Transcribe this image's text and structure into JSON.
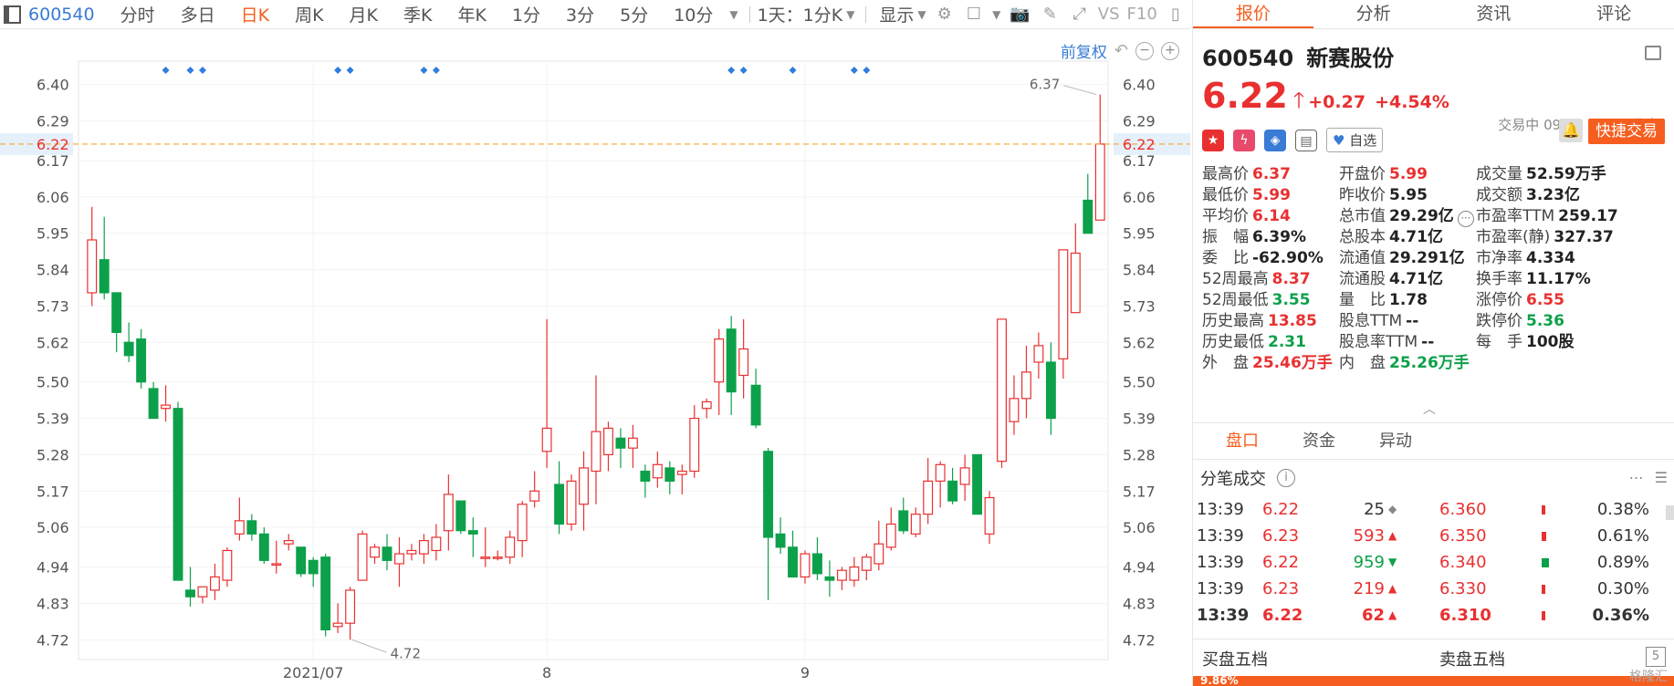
{
  "toolbar": {
    "code": "600540",
    "periods": [
      "分时",
      "多日",
      "日K",
      "周K",
      "月K",
      "季K",
      "年K",
      "1分",
      "3分",
      "5分",
      "10分"
    ],
    "active_period": "日K",
    "interval_select": "1天：1分K",
    "display_label": "显示",
    "vs_label": "VS",
    "f10_label": "F10"
  },
  "chart": {
    "adjust_label": "前复权",
    "y_ticks": [
      "6.40",
      "6.29",
      "6.17",
      "6.06",
      "5.95",
      "5.84",
      "5.73",
      "5.62",
      "5.50",
      "5.39",
      "5.28",
      "5.17",
      "5.06",
      "4.94",
      "4.83",
      "4.72"
    ],
    "current_price_label": "6.22",
    "high_annotation": "6.37",
    "low_annotation": "4.72",
    "x_labels": [
      "2021/07",
      "8",
      "9"
    ],
    "colors": {
      "up": "#e93030",
      "down": "#0da04a",
      "price_line": "#f5a623",
      "marker": "#2f7de1"
    }
  },
  "chart_data": {
    "type": "candlestick",
    "y_range": [
      4.66,
      6.46
    ],
    "x_labels": [
      {
        "label": "2021/07",
        "index": 18
      },
      {
        "label": "8",
        "index": 37
      },
      {
        "label": "9",
        "index": 58
      }
    ],
    "event_marker_indices": [
      6,
      8,
      9,
      20,
      21,
      27,
      28,
      52,
      53,
      57,
      62,
      63
    ],
    "candles": [
      {
        "o": 5.77,
        "h": 6.03,
        "l": 5.73,
        "c": 5.93
      },
      {
        "o": 5.87,
        "h": 6.0,
        "l": 5.75,
        "c": 5.77
      },
      {
        "o": 5.77,
        "h": 5.77,
        "l": 5.59,
        "c": 5.65
      },
      {
        "o": 5.62,
        "h": 5.68,
        "l": 5.56,
        "c": 5.58
      },
      {
        "o": 5.63,
        "h": 5.66,
        "l": 5.48,
        "c": 5.5
      },
      {
        "o": 5.48,
        "h": 5.5,
        "l": 5.39,
        "c": 5.39
      },
      {
        "o": 5.42,
        "h": 5.49,
        "l": 5.38,
        "c": 5.43
      },
      {
        "o": 5.42,
        "h": 5.44,
        "l": 4.9,
        "c": 4.9
      },
      {
        "o": 4.87,
        "h": 4.94,
        "l": 4.82,
        "c": 4.85
      },
      {
        "o": 4.85,
        "h": 4.88,
        "l": 4.83,
        "c": 4.88
      },
      {
        "o": 4.87,
        "h": 4.95,
        "l": 4.84,
        "c": 4.91
      },
      {
        "o": 4.9,
        "h": 5.0,
        "l": 4.88,
        "c": 4.99
      },
      {
        "o": 5.04,
        "h": 5.15,
        "l": 5.02,
        "c": 5.08
      },
      {
        "o": 5.08,
        "h": 5.1,
        "l": 5.02,
        "c": 5.04
      },
      {
        "o": 5.04,
        "h": 5.06,
        "l": 4.95,
        "c": 4.96
      },
      {
        "o": 4.95,
        "h": 5.02,
        "l": 4.92,
        "c": 4.95
      },
      {
        "o": 5.01,
        "h": 5.04,
        "l": 4.99,
        "c": 5.02
      },
      {
        "o": 5.0,
        "h": 5.0,
        "l": 4.91,
        "c": 4.92
      },
      {
        "o": 4.96,
        "h": 4.97,
        "l": 4.88,
        "c": 4.92
      },
      {
        "o": 4.97,
        "h": 4.98,
        "l": 4.73,
        "c": 4.75
      },
      {
        "o": 4.76,
        "h": 4.83,
        "l": 4.74,
        "c": 4.77
      },
      {
        "o": 4.77,
        "h": 4.88,
        "l": 4.72,
        "c": 4.87
      },
      {
        "o": 4.9,
        "h": 5.05,
        "l": 4.9,
        "c": 5.04
      },
      {
        "o": 4.97,
        "h": 5.01,
        "l": 4.95,
        "c": 5.0
      },
      {
        "o": 5.0,
        "h": 5.04,
        "l": 4.93,
        "c": 4.96
      },
      {
        "o": 4.95,
        "h": 5.03,
        "l": 4.88,
        "c": 4.98
      },
      {
        "o": 4.98,
        "h": 5.01,
        "l": 4.96,
        "c": 4.99
      },
      {
        "o": 4.98,
        "h": 5.04,
        "l": 4.95,
        "c": 5.02
      },
      {
        "o": 4.99,
        "h": 5.07,
        "l": 4.96,
        "c": 5.03
      },
      {
        "o": 5.05,
        "h": 5.22,
        "l": 4.99,
        "c": 5.16
      },
      {
        "o": 5.14,
        "h": 5.14,
        "l": 5.04,
        "c": 5.05
      },
      {
        "o": 5.05,
        "h": 5.09,
        "l": 4.97,
        "c": 5.04
      },
      {
        "o": 4.97,
        "h": 5.06,
        "l": 4.94,
        "c": 4.97
      },
      {
        "o": 4.97,
        "h": 4.99,
        "l": 4.96,
        "c": 4.97
      },
      {
        "o": 4.97,
        "h": 5.05,
        "l": 4.95,
        "c": 5.03
      },
      {
        "o": 5.02,
        "h": 5.14,
        "l": 4.97,
        "c": 5.13
      },
      {
        "o": 5.14,
        "h": 5.23,
        "l": 5.12,
        "c": 5.17
      },
      {
        "o": 5.29,
        "h": 5.69,
        "l": 5.24,
        "c": 5.36
      },
      {
        "o": 5.19,
        "h": 5.26,
        "l": 5.04,
        "c": 5.07
      },
      {
        "o": 5.07,
        "h": 5.22,
        "l": 5.05,
        "c": 5.2
      },
      {
        "o": 5.13,
        "h": 5.29,
        "l": 5.05,
        "c": 5.24
      },
      {
        "o": 5.23,
        "h": 5.52,
        "l": 5.13,
        "c": 5.35
      },
      {
        "o": 5.28,
        "h": 5.38,
        "l": 5.23,
        "c": 5.36
      },
      {
        "o": 5.33,
        "h": 5.36,
        "l": 5.24,
        "c": 5.3
      },
      {
        "o": 5.3,
        "h": 5.37,
        "l": 5.24,
        "c": 5.33
      },
      {
        "o": 5.23,
        "h": 5.25,
        "l": 5.15,
        "c": 5.2
      },
      {
        "o": 5.21,
        "h": 5.29,
        "l": 5.18,
        "c": 5.25
      },
      {
        "o": 5.24,
        "h": 5.26,
        "l": 5.16,
        "c": 5.2
      },
      {
        "o": 5.22,
        "h": 5.25,
        "l": 5.16,
        "c": 5.23
      },
      {
        "o": 5.23,
        "h": 5.43,
        "l": 5.21,
        "c": 5.39
      },
      {
        "o": 5.42,
        "h": 5.45,
        "l": 5.39,
        "c": 5.44
      },
      {
        "o": 5.5,
        "h": 5.66,
        "l": 5.4,
        "c": 5.63
      },
      {
        "o": 5.66,
        "h": 5.7,
        "l": 5.4,
        "c": 5.47
      },
      {
        "o": 5.52,
        "h": 5.69,
        "l": 5.45,
        "c": 5.6
      },
      {
        "o": 5.49,
        "h": 5.54,
        "l": 5.36,
        "c": 5.37
      },
      {
        "o": 5.29,
        "h": 5.3,
        "l": 4.84,
        "c": 5.03
      },
      {
        "o": 5.04,
        "h": 5.09,
        "l": 4.98,
        "c": 5.0
      },
      {
        "o": 5.0,
        "h": 5.05,
        "l": 4.91,
        "c": 4.91
      },
      {
        "o": 4.91,
        "h": 4.99,
        "l": 4.89,
        "c": 4.98
      },
      {
        "o": 4.98,
        "h": 5.03,
        "l": 4.9,
        "c": 4.92
      },
      {
        "o": 4.91,
        "h": 4.96,
        "l": 4.85,
        "c": 4.9
      },
      {
        "o": 4.9,
        "h": 4.94,
        "l": 4.87,
        "c": 4.93
      },
      {
        "o": 4.9,
        "h": 4.97,
        "l": 4.88,
        "c": 4.94
      },
      {
        "o": 4.93,
        "h": 4.98,
        "l": 4.9,
        "c": 4.97
      },
      {
        "o": 4.95,
        "h": 5.08,
        "l": 4.93,
        "c": 5.01
      },
      {
        "o": 5.0,
        "h": 5.12,
        "l": 4.99,
        "c": 5.07
      },
      {
        "o": 5.11,
        "h": 5.15,
        "l": 5.04,
        "c": 5.05
      },
      {
        "o": 5.04,
        "h": 5.12,
        "l": 5.03,
        "c": 5.1
      },
      {
        "o": 5.1,
        "h": 5.27,
        "l": 5.07,
        "c": 5.2
      },
      {
        "o": 5.2,
        "h": 5.26,
        "l": 5.12,
        "c": 5.25
      },
      {
        "o": 5.2,
        "h": 5.24,
        "l": 5.13,
        "c": 5.14
      },
      {
        "o": 5.19,
        "h": 5.28,
        "l": 5.14,
        "c": 5.24
      },
      {
        "o": 5.28,
        "h": 5.28,
        "l": 5.1,
        "c": 5.1
      },
      {
        "o": 5.04,
        "h": 5.17,
        "l": 5.01,
        "c": 5.15
      },
      {
        "o": 5.26,
        "h": 5.69,
        "l": 5.24,
        "c": 5.69
      },
      {
        "o": 5.38,
        "h": 5.52,
        "l": 5.34,
        "c": 5.45
      },
      {
        "o": 5.45,
        "h": 5.61,
        "l": 5.39,
        "c": 5.53
      },
      {
        "o": 5.56,
        "h": 5.65,
        "l": 5.51,
        "c": 5.61
      },
      {
        "o": 5.56,
        "h": 5.62,
        "l": 5.34,
        "c": 5.39
      },
      {
        "o": 5.57,
        "h": 5.66,
        "l": 5.51,
        "c": 5.9
      },
      {
        "o": 5.71,
        "h": 5.98,
        "l": 5.71,
        "c": 5.89
      },
      {
        "o": 6.05,
        "h": 6.13,
        "l": 5.95,
        "c": 5.95
      },
      {
        "o": 5.99,
        "h": 6.37,
        "l": 5.99,
        "c": 6.22
      }
    ]
  },
  "panel": {
    "tabs": [
      "报价",
      "分析",
      "资讯",
      "评论"
    ],
    "active_tab": "报价",
    "code": "600540",
    "name": "新赛股份",
    "price": "6.22",
    "change": "+0.27",
    "change_pct": "+4.54%",
    "status_time": "交易中 09/29 13:39(北京)",
    "fav_label": "自选",
    "quick_trade_label": "快捷交易",
    "stats": [
      {
        "label": "最高价",
        "value": "6.37",
        "color": "red"
      },
      {
        "label": "开盘价",
        "value": "5.99",
        "color": "red"
      },
      {
        "label": "成交量",
        "value": "52.59万手",
        "color": "dark"
      },
      {
        "label": "最低价",
        "value": "5.99",
        "color": "red"
      },
      {
        "label": "昨收价",
        "value": "5.95",
        "color": "dark"
      },
      {
        "label": "成交额",
        "value": "3.23亿",
        "color": "dark"
      },
      {
        "label": "平均价",
        "value": "6.14",
        "color": "red"
      },
      {
        "label": "总市值",
        "value": "29.29亿",
        "color": "dark"
      },
      {
        "label": "市盈率TTM",
        "value": "259.17",
        "color": "dark"
      },
      {
        "label": "振　幅",
        "value": "6.39%",
        "color": "dark"
      },
      {
        "label": "总股本",
        "value": "4.71亿",
        "color": "dark"
      },
      {
        "label": "市盈率(静)",
        "value": "327.37",
        "color": "dark"
      },
      {
        "label": "委　比",
        "value": "-62.90%",
        "color": "dark"
      },
      {
        "label": "流通值",
        "value": "29.291亿",
        "color": "dark"
      },
      {
        "label": "市净率",
        "value": "4.334",
        "color": "dark"
      },
      {
        "label": "52周最高",
        "value": "8.37",
        "color": "red"
      },
      {
        "label": "流通股",
        "value": "4.71亿",
        "color": "dark"
      },
      {
        "label": "换手率",
        "value": "11.17%",
        "color": "dark"
      },
      {
        "label": "52周最低",
        "value": "3.55",
        "color": "green"
      },
      {
        "label": "量　比",
        "value": "1.78",
        "color": "dark"
      },
      {
        "label": "涨停价",
        "value": "6.55",
        "color": "red"
      },
      {
        "label": "历史最高",
        "value": "13.85",
        "color": "red"
      },
      {
        "label": "股息TTM",
        "value": "--",
        "color": "dark"
      },
      {
        "label": "跌停价",
        "value": "5.36",
        "color": "green"
      },
      {
        "label": "历史最低",
        "value": "2.31",
        "color": "green"
      },
      {
        "label": "股息率TTM",
        "value": "--",
        "color": "dark"
      },
      {
        "label": "每　手",
        "value": "100股",
        "color": "dark"
      },
      {
        "label": "外　盘",
        "value": "25.46万手",
        "color": "red"
      },
      {
        "label": "内　盘",
        "value": "25.26万手",
        "color": "green"
      }
    ],
    "sub_tabs": [
      "盘口",
      "资金",
      "异动"
    ],
    "active_sub_tab": "盘口",
    "ticks_title": "分笔成交",
    "ticks": [
      {
        "time": "13:39",
        "price": "6.22",
        "vol": "25",
        "dir": "flat",
        "bprice": "6.360",
        "bar": 0.05,
        "pct": "0.38%"
      },
      {
        "time": "13:39",
        "price": "6.23",
        "vol": "593",
        "dir": "up",
        "bprice": "6.350",
        "bar": 0.09,
        "pct": "0.61%"
      },
      {
        "time": "13:39",
        "price": "6.22",
        "vol": "959",
        "dir": "down",
        "bprice": "6.340",
        "bar": 0.14,
        "pct": "0.89%"
      },
      {
        "time": "13:39",
        "price": "6.23",
        "vol": "219",
        "dir": "up",
        "bprice": "6.330",
        "bar": 0.04,
        "pct": "0.30%"
      },
      {
        "time": "13:39",
        "price": "6.22",
        "vol": "62",
        "dir": "up",
        "bprice": "6.310",
        "bar": 0.05,
        "pct": "0.36%"
      }
    ],
    "buy_five_label": "买盘五档",
    "sell_five_label": "卖盘五档",
    "bid_ratio": "9.86%",
    "watermark": "格隆汇"
  }
}
